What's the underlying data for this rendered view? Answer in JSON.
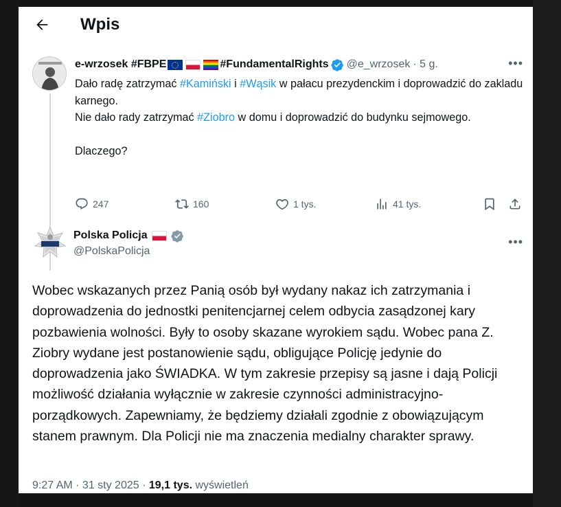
{
  "header": {
    "title": "Wpis"
  },
  "reply_to": {
    "name": "e-wrzosek #FBPE",
    "name_suffix": "#FundamentalRights",
    "handle": "@e_wrzosek",
    "time": "· 5 g.",
    "text": {
      "p1_a": "Dało radę zatrzymać ",
      "tag_kaminski": "#Kamiński",
      "p1_b": " i ",
      "tag_wasik": "#Wąsik",
      "p1_c": " w pałacu prezydenckim i doprowadzić do zakladu karnego.",
      "p2_a": "Nie dało rady zatrzymać ",
      "tag_ziobro": "#Ziobro",
      "p2_b": " w domu i doprowadzić do budynku sejmowego.",
      "p3": "Dlaczego?"
    },
    "stats": {
      "replies": "247",
      "retweets": "160",
      "likes": "1 tys.",
      "views": "41 tys."
    }
  },
  "main_tweet": {
    "name": "Polska Policja",
    "handle": "@PolskaPolicja",
    "text": "Wobec wskazanych przez Panią osób był wydany nakaz ich zatrzymania i doprowadzenia do jednostki penitencjarnej celem odbycia zasądzonej kary pozbawienia wolności. Były to osoby skazane wyrokiem sądu. Wobec pana Z. Ziobry wydane jest postanowienie sądu, obligujące Policję jedynie do doprowadzenia jako ŚWIADKA.  W tym zakresie przepisy są jasne i dają Policji możliwość działania wyłącznie w zakresie czynności administracyjno-porządkowych. Zapewniamy, że będziemy działali zgodnie z obowiązującym stanem prawnym. Dla Policji nie ma znaczenia medialny charakter sprawy.",
    "time": "9:27 AM · 31 sty 2025 · ",
    "views_count": "19,1 tys.",
    "views_label": " wyświetleń"
  },
  "colors": {
    "accent": "#1d9bf0",
    "text": "#0f1419",
    "muted": "#536471"
  },
  "icons": [
    "back-arrow-icon",
    "verified-badge-icon",
    "more-icon",
    "reply-icon",
    "retweet-icon",
    "like-icon",
    "views-icon",
    "bookmark-icon",
    "share-icon",
    "police-star-icon"
  ]
}
